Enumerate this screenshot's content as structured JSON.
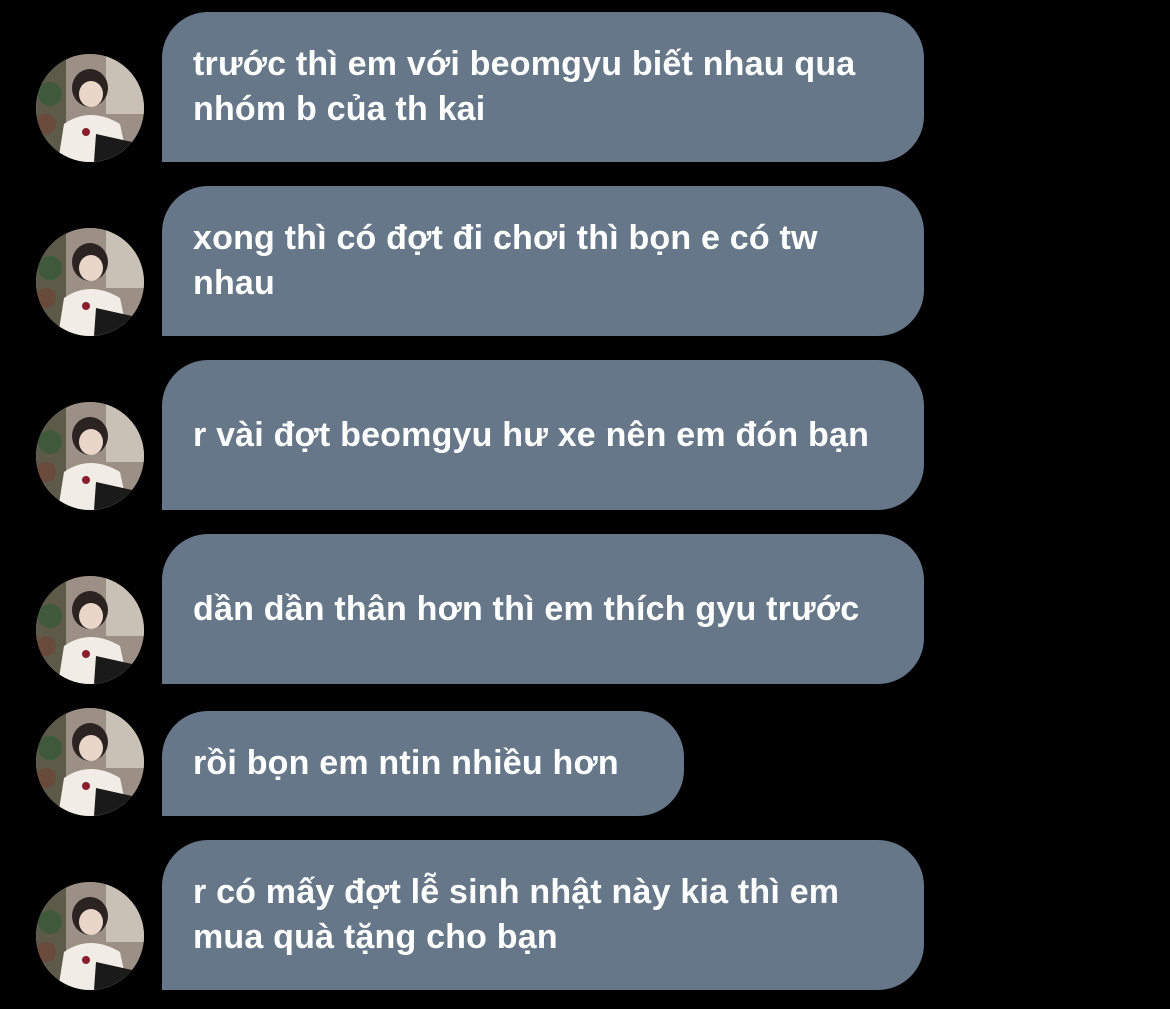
{
  "conversation": {
    "messages": [
      {
        "text": "trước thì em với beomgyu biết nhau qua nhóm b của th kai",
        "avatar_icon": "profile-photo"
      },
      {
        "text": "xong thì có đợt đi chơi thì bọn e có tw nhau",
        "avatar_icon": "profile-photo"
      },
      {
        "text": "r vài đợt beomgyu hư xe nên em đón bạn",
        "avatar_icon": "profile-photo"
      },
      {
        "text": "dần dần thân hơn thì em thích gyu trước",
        "avatar_icon": "profile-photo"
      },
      {
        "text": "rồi bọn em ntin nhiều hơn",
        "avatar_icon": "profile-photo"
      },
      {
        "text": "r có mấy đợt lễ sinh nhật này kia thì em mua quà tặng cho bạn",
        "avatar_icon": "profile-photo"
      }
    ]
  },
  "colors": {
    "background": "#000000",
    "bubble": "#67778a",
    "text": "#ffffff"
  }
}
